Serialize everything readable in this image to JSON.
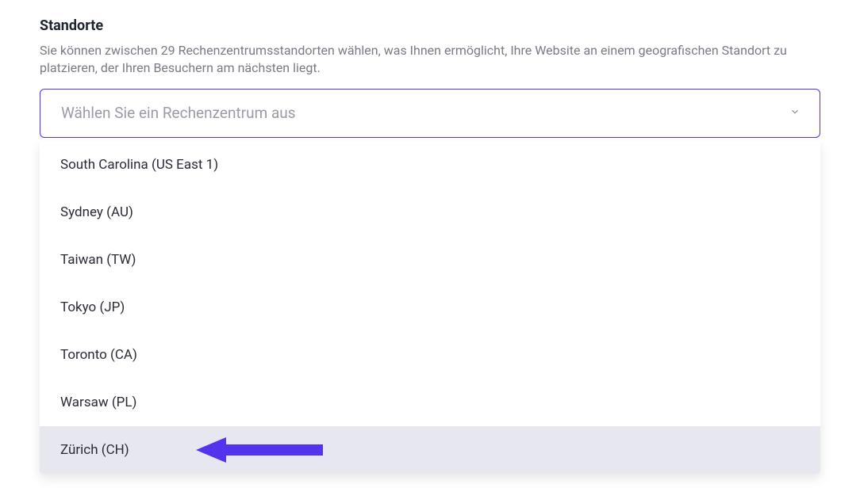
{
  "heading": "Standorte",
  "description": "Sie können zwischen 29 Rechenzentrumsstandorten wählen, was Ihnen ermöglicht, Ihre Website an einem geografischen Standort zu platzieren, der Ihren Besuchern am nächsten liegt.",
  "select": {
    "placeholder": "Wählen Sie ein Rechenzentrum aus"
  },
  "options": [
    {
      "label": "South Carolina (US East 1)",
      "highlighted": false
    },
    {
      "label": "Sydney (AU)",
      "highlighted": false
    },
    {
      "label": "Taiwan (TW)",
      "highlighted": false
    },
    {
      "label": "Tokyo (JP)",
      "highlighted": false
    },
    {
      "label": "Toronto (CA)",
      "highlighted": false
    },
    {
      "label": "Warsaw (PL)",
      "highlighted": false
    },
    {
      "label": "Zürich (CH)",
      "highlighted": true
    }
  ],
  "colors": {
    "accent": "#5333ed"
  }
}
